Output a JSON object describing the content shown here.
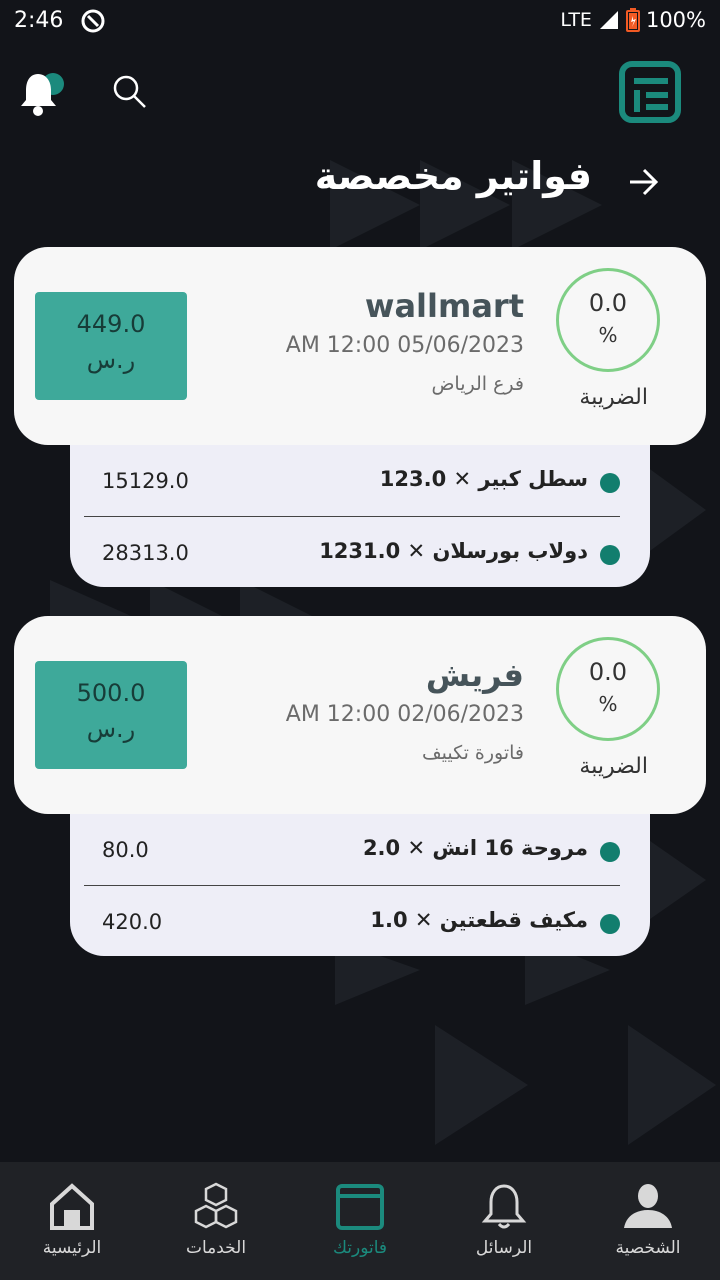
{
  "status_bar": {
    "time": "2:46",
    "network": "LTE",
    "battery": "100%"
  },
  "header": {
    "title": "فواتير مخصصة"
  },
  "invoices": [
    {
      "name": "wallmart",
      "date": "AM 12:00 05/06/2023",
      "branch": "فرع الرياض",
      "amount": "449.0",
      "currency": "ر.س",
      "tax_value": "0.0",
      "tax_percent": "%",
      "tax_label": "الضريبة",
      "items": [
        {
          "label": "سطل كبير ✕ 123.0",
          "total": "15129.0"
        },
        {
          "label": "دولاب بورسلان ✕ 1231.0",
          "total": "28313.0"
        }
      ]
    },
    {
      "name": "فريش",
      "date": "AM 12:00 02/06/2023",
      "branch": "فاتورة تكييف",
      "amount": "500.0",
      "currency": "ر.س",
      "tax_value": "0.0",
      "tax_percent": "%",
      "tax_label": "الضريبة",
      "items": [
        {
          "label": "مروحة 16 انش ✕ 2.0",
          "total": "80.0"
        },
        {
          "label": "مكيف قطعتين ✕ 1.0",
          "total": "420.0"
        }
      ]
    }
  ],
  "nav": {
    "home": "الرئيسية",
    "services": "الخدمات",
    "invoices": "فاتورتك",
    "messages": "الرسائل",
    "profile": "الشخصية"
  },
  "colors": {
    "accent": "#3ea99a",
    "active_nav": "#1b8a7d",
    "background": "#121419",
    "tax_ring": "#7fcf86"
  }
}
